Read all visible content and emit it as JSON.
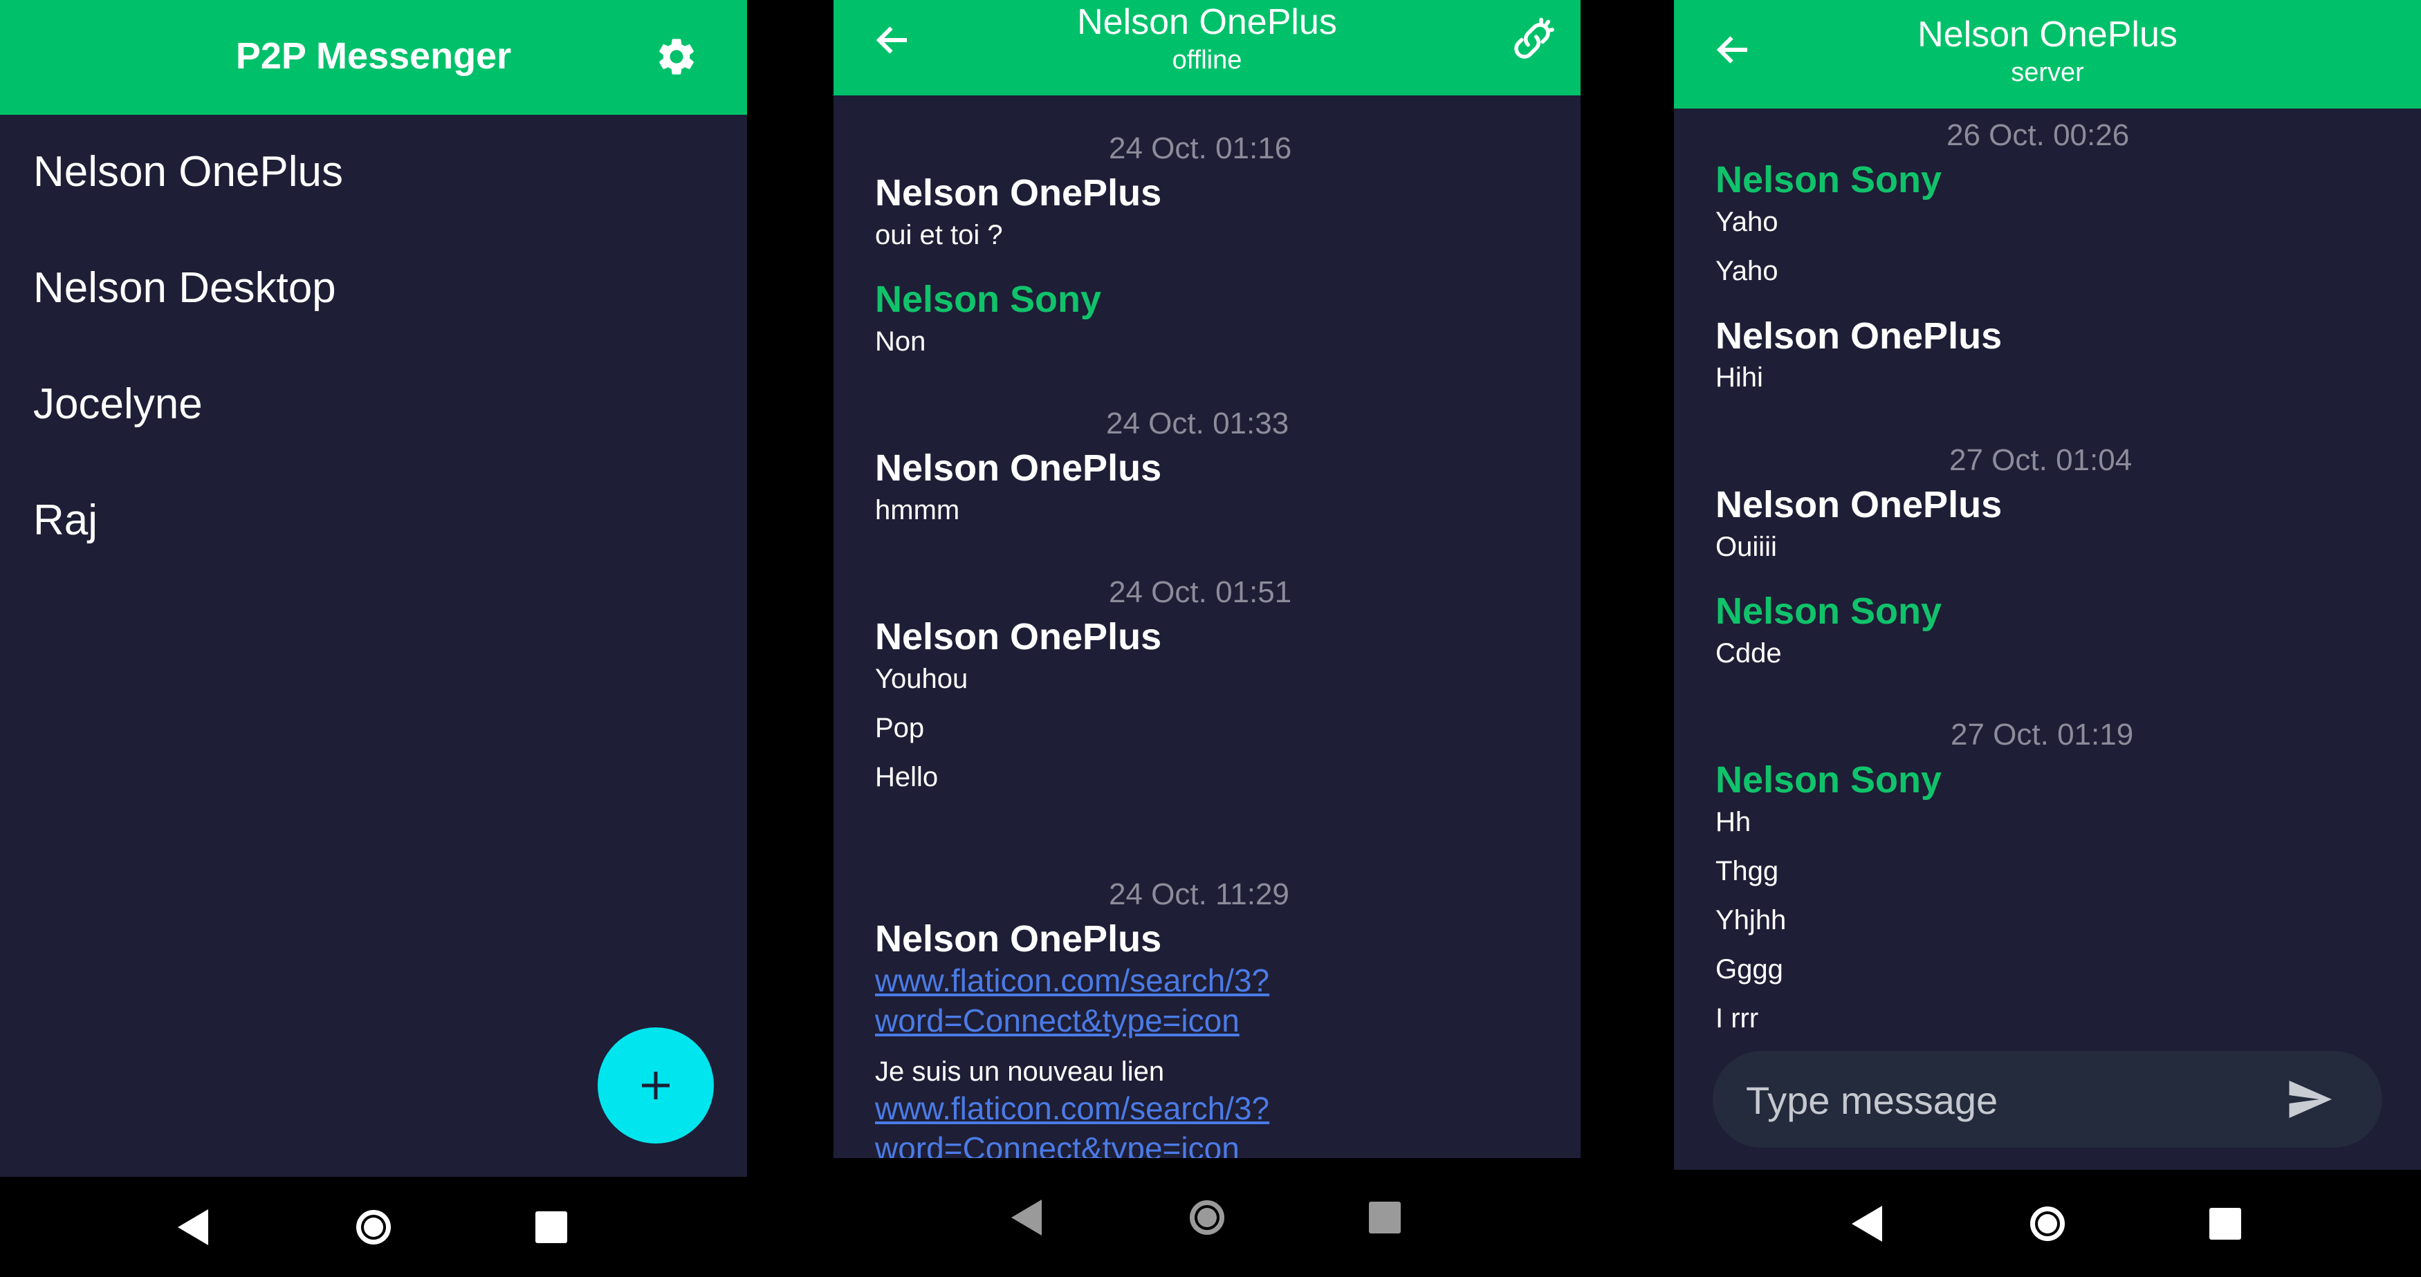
{
  "colors": {
    "accent": "#00c16a",
    "fab": "#00e5ee",
    "background": "#1e1e36",
    "link": "#4b7be6",
    "timestamp": "#8c8c9a"
  },
  "screen1": {
    "title": "P2P Messenger",
    "settings_icon": "gear-icon",
    "contacts": [
      "Nelson OnePlus",
      "Nelson Desktop",
      "Jocelyne",
      "Raj"
    ],
    "fab_label": "+"
  },
  "screen2": {
    "title": "Nelson OnePlus",
    "status": "offline",
    "link_icon": "broken-link-icon",
    "messages": [
      {
        "time": "24 Oct. 01:16",
        "sender": "Nelson OnePlus",
        "text": "oui et toi ?"
      },
      {
        "sender": "Nelson Sony",
        "text": "Non"
      },
      {
        "time": "24 Oct. 01:33",
        "sender": "Nelson OnePlus",
        "text": "hmmm"
      },
      {
        "time": "24 Oct. 01:51",
        "sender": "Nelson OnePlus",
        "lines": [
          "Youhou",
          "Pop",
          "Hello"
        ]
      },
      {
        "time": "24 Oct. 11:29",
        "sender": "Nelson OnePlus",
        "link1": [
          "www.flaticon.com/search/3?",
          "word=Connect&type=icon"
        ],
        "text": "Je suis un nouveau lien",
        "link2": [
          "www.flaticon.com/search/3?",
          "word=Connect&type=icon"
        ]
      }
    ]
  },
  "screen3": {
    "title": "Nelson OnePlus",
    "status": "server",
    "messages": [
      {
        "time": "26 Oct. 00:26",
        "sender": "Nelson Sony",
        "lines": [
          "Yaho",
          "Yaho"
        ]
      },
      {
        "sender": "Nelson OnePlus",
        "text": "Hihi"
      },
      {
        "time": "27 Oct. 01:04",
        "sender": "Nelson OnePlus",
        "text": "Ouiiii"
      },
      {
        "sender": "Nelson Sony",
        "text": "Cdde"
      },
      {
        "time": "27 Oct. 01:19",
        "sender": "Nelson Sony",
        "lines": [
          "Hh",
          "Thgg",
          "Yhjhh",
          "Gggg",
          "I rrr"
        ]
      }
    ],
    "input_placeholder": "Type message",
    "send_icon": "send-icon"
  }
}
